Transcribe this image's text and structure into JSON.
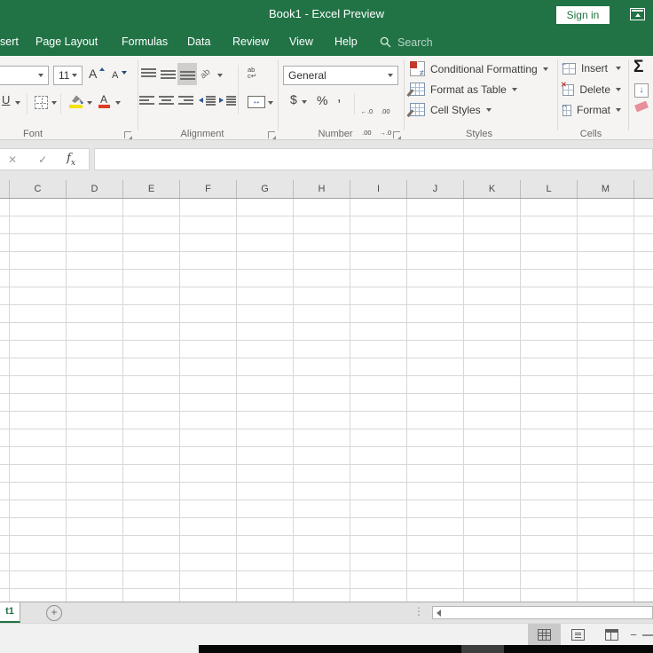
{
  "titlebar": {
    "title": "Book1  -  Excel Preview",
    "sign_in": "Sign in"
  },
  "tabs": {
    "insert_partial": "sert",
    "page_layout": "Page Layout",
    "formulas": "Formulas",
    "data": "Data",
    "review": "Review",
    "view": "View",
    "help": "Help",
    "search": "Search"
  },
  "font_group": {
    "label": "Font",
    "size": "11",
    "underline": "U",
    "grow": "A",
    "shrink": "A",
    "color_letter": "A"
  },
  "alignment_group": {
    "label": "Alignment",
    "orientation": "ab",
    "wrap_line1": "ab",
    "wrap_line2": "c↵"
  },
  "number_group": {
    "label": "Number",
    "format": "General",
    "currency": "$",
    "percent": "%",
    "comma": ",",
    "inc_top": "←.0",
    "inc_bottom": ".00",
    "dec_top": ".00",
    "dec_bottom": "→.0"
  },
  "styles_group": {
    "label": "Styles",
    "conditional_formatting": "Conditional Formatting",
    "format_as_table": "Format as Table",
    "cell_styles": "Cell Styles",
    "neq": "≠"
  },
  "cells_group": {
    "label": "Cells",
    "insert": "Insert",
    "delete": "Delete",
    "format": "Format",
    "insert_glyph": "←",
    "delete_glyph": "✕",
    "format_glyph": "↔"
  },
  "editing_group": {
    "autosum": "Σ",
    "fill_arrow": "↓"
  },
  "formula_bar": {
    "cancel": "✕",
    "enter": "✓",
    "fx_f": "f",
    "fx_x": "x"
  },
  "grid": {
    "columns": [
      "C",
      "D",
      "E",
      "F",
      "G",
      "H",
      "I",
      "J",
      "K",
      "L",
      "M"
    ]
  },
  "sheet_bar": {
    "active_tab": "t1",
    "add_sheet": "+",
    "dots": "⋮"
  },
  "status_bar": {
    "zoom_out": "−"
  },
  "colors": {
    "excel_green": "#217346",
    "gridline": "#d8d8d8",
    "fill_yellow": "#f4e20c",
    "font_red": "#e03b24"
  }
}
